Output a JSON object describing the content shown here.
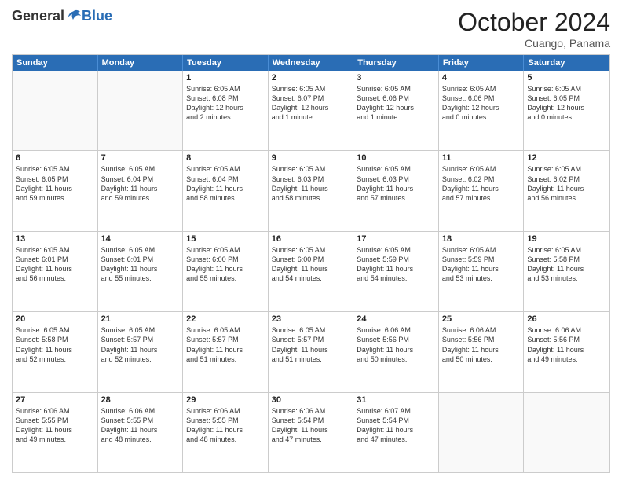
{
  "logo": {
    "general": "General",
    "blue": "Blue"
  },
  "title": "October 2024",
  "location": "Cuango, Panama",
  "days": [
    "Sunday",
    "Monday",
    "Tuesday",
    "Wednesday",
    "Thursday",
    "Friday",
    "Saturday"
  ],
  "rows": [
    [
      {
        "day": "",
        "empty": true
      },
      {
        "day": "",
        "empty": true
      },
      {
        "day": "1",
        "lines": [
          "Sunrise: 6:05 AM",
          "Sunset: 6:08 PM",
          "Daylight: 12 hours",
          "and 2 minutes."
        ]
      },
      {
        "day": "2",
        "lines": [
          "Sunrise: 6:05 AM",
          "Sunset: 6:07 PM",
          "Daylight: 12 hours",
          "and 1 minute."
        ]
      },
      {
        "day": "3",
        "lines": [
          "Sunrise: 6:05 AM",
          "Sunset: 6:06 PM",
          "Daylight: 12 hours",
          "and 1 minute."
        ]
      },
      {
        "day": "4",
        "lines": [
          "Sunrise: 6:05 AM",
          "Sunset: 6:06 PM",
          "Daylight: 12 hours",
          "and 0 minutes."
        ]
      },
      {
        "day": "5",
        "lines": [
          "Sunrise: 6:05 AM",
          "Sunset: 6:05 PM",
          "Daylight: 12 hours",
          "and 0 minutes."
        ]
      }
    ],
    [
      {
        "day": "6",
        "lines": [
          "Sunrise: 6:05 AM",
          "Sunset: 6:05 PM",
          "Daylight: 11 hours",
          "and 59 minutes."
        ]
      },
      {
        "day": "7",
        "lines": [
          "Sunrise: 6:05 AM",
          "Sunset: 6:04 PM",
          "Daylight: 11 hours",
          "and 59 minutes."
        ]
      },
      {
        "day": "8",
        "lines": [
          "Sunrise: 6:05 AM",
          "Sunset: 6:04 PM",
          "Daylight: 11 hours",
          "and 58 minutes."
        ]
      },
      {
        "day": "9",
        "lines": [
          "Sunrise: 6:05 AM",
          "Sunset: 6:03 PM",
          "Daylight: 11 hours",
          "and 58 minutes."
        ]
      },
      {
        "day": "10",
        "lines": [
          "Sunrise: 6:05 AM",
          "Sunset: 6:03 PM",
          "Daylight: 11 hours",
          "and 57 minutes."
        ]
      },
      {
        "day": "11",
        "lines": [
          "Sunrise: 6:05 AM",
          "Sunset: 6:02 PM",
          "Daylight: 11 hours",
          "and 57 minutes."
        ]
      },
      {
        "day": "12",
        "lines": [
          "Sunrise: 6:05 AM",
          "Sunset: 6:02 PM",
          "Daylight: 11 hours",
          "and 56 minutes."
        ]
      }
    ],
    [
      {
        "day": "13",
        "lines": [
          "Sunrise: 6:05 AM",
          "Sunset: 6:01 PM",
          "Daylight: 11 hours",
          "and 56 minutes."
        ]
      },
      {
        "day": "14",
        "lines": [
          "Sunrise: 6:05 AM",
          "Sunset: 6:01 PM",
          "Daylight: 11 hours",
          "and 55 minutes."
        ]
      },
      {
        "day": "15",
        "lines": [
          "Sunrise: 6:05 AM",
          "Sunset: 6:00 PM",
          "Daylight: 11 hours",
          "and 55 minutes."
        ]
      },
      {
        "day": "16",
        "lines": [
          "Sunrise: 6:05 AM",
          "Sunset: 6:00 PM",
          "Daylight: 11 hours",
          "and 54 minutes."
        ]
      },
      {
        "day": "17",
        "lines": [
          "Sunrise: 6:05 AM",
          "Sunset: 5:59 PM",
          "Daylight: 11 hours",
          "and 54 minutes."
        ]
      },
      {
        "day": "18",
        "lines": [
          "Sunrise: 6:05 AM",
          "Sunset: 5:59 PM",
          "Daylight: 11 hours",
          "and 53 minutes."
        ]
      },
      {
        "day": "19",
        "lines": [
          "Sunrise: 6:05 AM",
          "Sunset: 5:58 PM",
          "Daylight: 11 hours",
          "and 53 minutes."
        ]
      }
    ],
    [
      {
        "day": "20",
        "lines": [
          "Sunrise: 6:05 AM",
          "Sunset: 5:58 PM",
          "Daylight: 11 hours",
          "and 52 minutes."
        ]
      },
      {
        "day": "21",
        "lines": [
          "Sunrise: 6:05 AM",
          "Sunset: 5:57 PM",
          "Daylight: 11 hours",
          "and 52 minutes."
        ]
      },
      {
        "day": "22",
        "lines": [
          "Sunrise: 6:05 AM",
          "Sunset: 5:57 PM",
          "Daylight: 11 hours",
          "and 51 minutes."
        ]
      },
      {
        "day": "23",
        "lines": [
          "Sunrise: 6:05 AM",
          "Sunset: 5:57 PM",
          "Daylight: 11 hours",
          "and 51 minutes."
        ]
      },
      {
        "day": "24",
        "lines": [
          "Sunrise: 6:06 AM",
          "Sunset: 5:56 PM",
          "Daylight: 11 hours",
          "and 50 minutes."
        ]
      },
      {
        "day": "25",
        "lines": [
          "Sunrise: 6:06 AM",
          "Sunset: 5:56 PM",
          "Daylight: 11 hours",
          "and 50 minutes."
        ]
      },
      {
        "day": "26",
        "lines": [
          "Sunrise: 6:06 AM",
          "Sunset: 5:56 PM",
          "Daylight: 11 hours",
          "and 49 minutes."
        ]
      }
    ],
    [
      {
        "day": "27",
        "lines": [
          "Sunrise: 6:06 AM",
          "Sunset: 5:55 PM",
          "Daylight: 11 hours",
          "and 49 minutes."
        ]
      },
      {
        "day": "28",
        "lines": [
          "Sunrise: 6:06 AM",
          "Sunset: 5:55 PM",
          "Daylight: 11 hours",
          "and 48 minutes."
        ]
      },
      {
        "day": "29",
        "lines": [
          "Sunrise: 6:06 AM",
          "Sunset: 5:55 PM",
          "Daylight: 11 hours",
          "and 48 minutes."
        ]
      },
      {
        "day": "30",
        "lines": [
          "Sunrise: 6:06 AM",
          "Sunset: 5:54 PM",
          "Daylight: 11 hours",
          "and 47 minutes."
        ]
      },
      {
        "day": "31",
        "lines": [
          "Sunrise: 6:07 AM",
          "Sunset: 5:54 PM",
          "Daylight: 11 hours",
          "and 47 minutes."
        ]
      },
      {
        "day": "",
        "empty": true
      },
      {
        "day": "",
        "empty": true
      }
    ]
  ]
}
